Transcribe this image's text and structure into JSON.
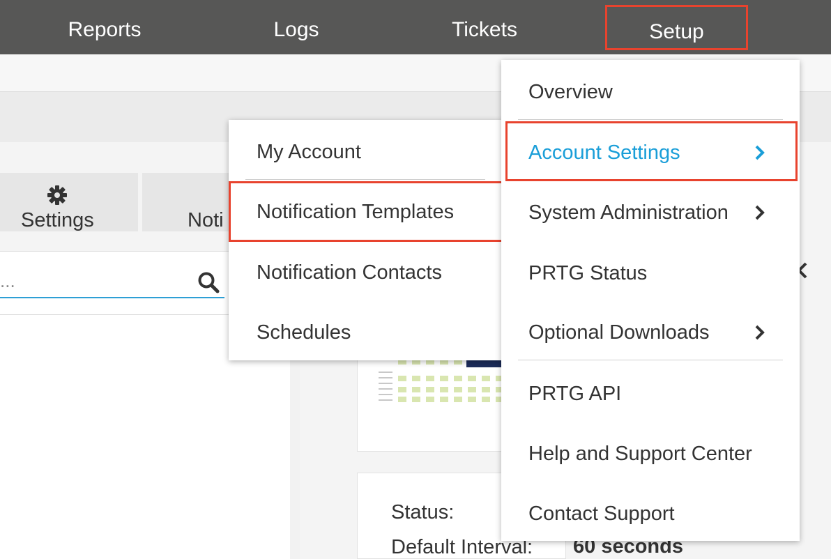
{
  "topnav": {
    "items": [
      {
        "label": "Reports"
      },
      {
        "label": "Logs"
      },
      {
        "label": "Tickets"
      },
      {
        "label": "Setup"
      }
    ]
  },
  "tabs": {
    "settings_label": "Settings",
    "notifications_label": "Noti"
  },
  "search": {
    "placeholder": "...",
    "icon": "search-icon"
  },
  "details": {
    "status_label": "Status:",
    "interval_label": "Default Interval:",
    "interval_value": "60 seconds"
  },
  "setup_menu": {
    "items": [
      {
        "label": "Overview"
      },
      {
        "label": "Account Settings",
        "has_submenu": true,
        "active": true
      },
      {
        "label": "System Administration",
        "has_submenu": true
      },
      {
        "label": "PRTG Status"
      },
      {
        "label": "Optional Downloads",
        "has_submenu": true
      },
      {
        "label": "PRTG API"
      },
      {
        "label": "Help and Support Center"
      },
      {
        "label": "Contact Support"
      }
    ]
  },
  "account_submenu": {
    "items": [
      {
        "label": "My Account"
      },
      {
        "label": "Notification Templates",
        "highlighted": true
      },
      {
        "label": "Notification Contacts"
      },
      {
        "label": "Schedules"
      }
    ]
  },
  "colors": {
    "nav_bg": "#575756",
    "accent_blue": "#1a9ed8",
    "highlight_red": "#e8432e"
  }
}
